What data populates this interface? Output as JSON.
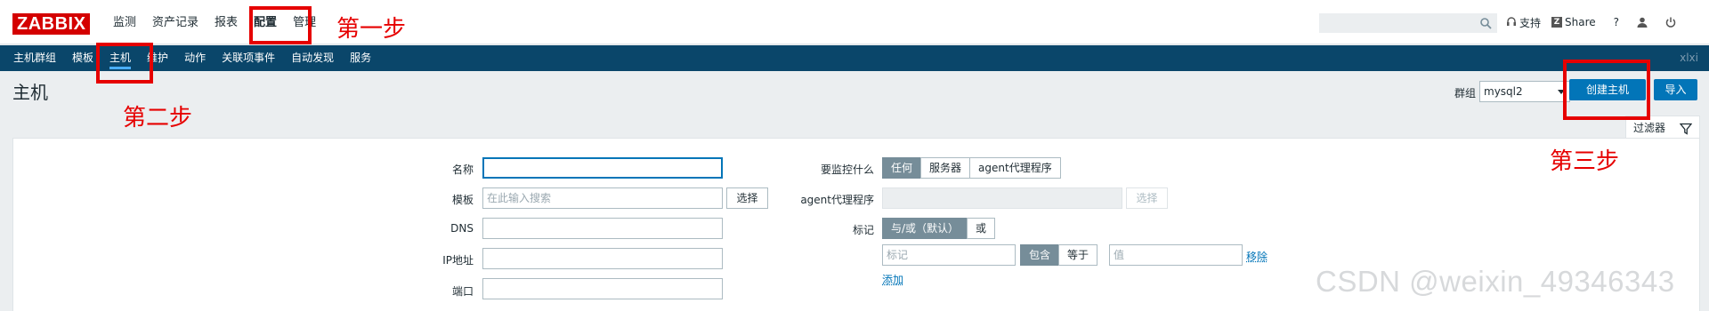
{
  "app": {
    "logo": "ZABBIX"
  },
  "top_menu": [
    {
      "label": "监测"
    },
    {
      "label": "资产记录"
    },
    {
      "label": "报表"
    },
    {
      "label": "配置"
    },
    {
      "label": "管理"
    }
  ],
  "top_right": {
    "search_value": "",
    "support": "支持",
    "share": "Share",
    "help": "?"
  },
  "sub_menu": [
    {
      "label": "主机群组"
    },
    {
      "label": "模板"
    },
    {
      "label": "主机"
    },
    {
      "label": "维护"
    },
    {
      "label": "动作"
    },
    {
      "label": "关联项事件"
    },
    {
      "label": "自动发现"
    },
    {
      "label": "服务"
    }
  ],
  "sub_user": "xlxi",
  "page": {
    "title": "主机",
    "group_label": "群组",
    "group_value": "mysql2",
    "create_button": "创建主机",
    "import_button": "导入",
    "filter_tab": "过滤器"
  },
  "filter": {
    "name_label": "名称",
    "name_value": "",
    "template_label": "模板",
    "template_placeholder": "在此输入搜索",
    "template_select": "选择",
    "dns_label": "DNS",
    "ip_label": "IP地址",
    "port_label": "端口",
    "monitor_label": "要监控什么",
    "monitor_options": [
      "任何",
      "服务器",
      "agent代理程序"
    ],
    "proxy_label": "agent代理程序",
    "proxy_select": "选择",
    "tags_label": "标记",
    "tags_mode_options": [
      "与/或（默认）",
      "或"
    ],
    "tag_placeholder": "标记",
    "tag_operator_options": [
      "包含",
      "等于"
    ],
    "value_placeholder": "值",
    "remove_link": "移除",
    "add_link": "添加"
  },
  "annotations": {
    "step1": "第一步",
    "step2": "第二步",
    "step3": "第三步",
    "color": "#e60000"
  },
  "watermark": "CSDN @weixin_49346343"
}
